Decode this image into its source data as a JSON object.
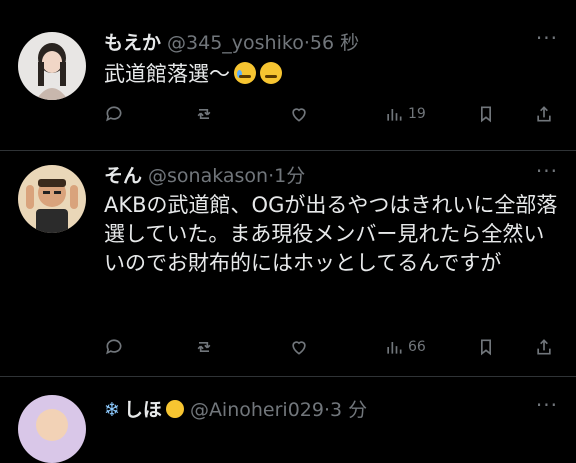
{
  "tweets": [
    {
      "name": "もえか",
      "handle": "@345_yoshiko·56 秒",
      "text": "武道館落選〜",
      "more": "···",
      "actions": {
        "like_count": "19"
      }
    },
    {
      "name": "そん",
      "handle": "@sonakason·1分",
      "text": "AKBの武道館、OGが出るやつはきれいに全部落選していた。まあ現役メンバー見れたら全然いいのでお財布的にはホッとしてるんですが",
      "more": "···",
      "actions": {
        "like_count": "66"
      }
    },
    {
      "name": "しほ",
      "handle": "@Ainoheri029·3 分",
      "text": "",
      "more": "···"
    }
  ],
  "icons": [
    "reply-icon",
    "retweet-icon",
    "like-icon",
    "views-icon",
    "bookmark-icon",
    "share-icon",
    "more-icon"
  ],
  "colors": {
    "background": "#000000",
    "text": "#e7e9ea",
    "muted": "#71767b",
    "divider": "#2f3336"
  }
}
